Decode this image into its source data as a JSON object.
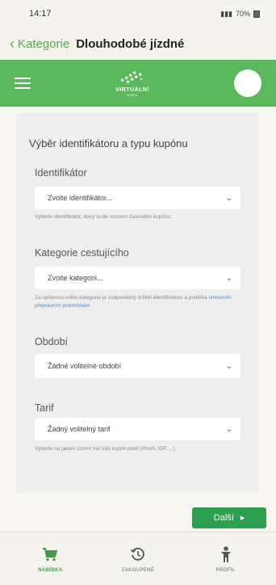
{
  "status_bar": {
    "time": "14:17",
    "right": "70%"
  },
  "nav": {
    "back_label": "Kategorie",
    "title": "Dlouhodobé jízdné"
  },
  "header": {
    "logo_text": "VIRTUÁLNÍ",
    "logo_sub": "KARTA"
  },
  "form": {
    "title": "Výběr identifikátoru a typu kupónu",
    "identifier": {
      "label": "Identifikátor",
      "value": "Zvolte identifikátor...",
      "help": "Vyberte identifikátor, který bude nositem časového kupónu."
    },
    "category": {
      "label": "Kategorie cestujícího",
      "value": "Zvolte kategorii...",
      "help_prefix": "Za správnou volbu kategorie je zodpovědný držitel identifikátoru a podléhá",
      "help_link": "smluvním přepravním podmínkám"
    },
    "period": {
      "label": "Období",
      "value": "Žádné volitelné období"
    },
    "tariff": {
      "label": "Tarif",
      "value": "Žádný volitelný tarif",
      "help": "Vyberte na jakém území má Váš kupón platit (Plzeň, IDP, ...)"
    },
    "next_label": "Další"
  },
  "bottom_nav": {
    "items": [
      {
        "label": "NABÍDKA",
        "icon": "cart-icon",
        "active": true
      },
      {
        "label": "ZAKOUPENÉ",
        "icon": "history-icon",
        "active": false
      },
      {
        "label": "PROFIL",
        "icon": "person-icon",
        "active": false
      }
    ]
  },
  "colors": {
    "brand_green": "#5cb85c",
    "button_green": "#2e9e4f",
    "link_blue": "#4b8bd6"
  }
}
